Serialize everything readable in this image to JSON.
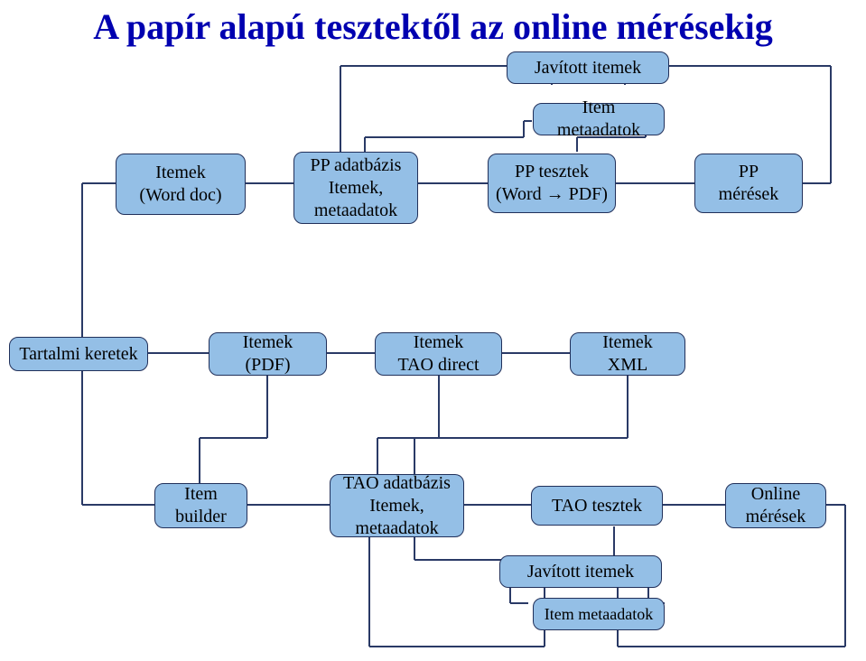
{
  "title": "A papír alapú tesztektől az online mérésekig",
  "boxes": {
    "javitott_itemek_top": "Javított itemek",
    "item_metaadatok_top": "Item metaadatok",
    "itemek_worddoc": "Itemek\n(Word doc)",
    "pp_adatbazis": "PP adatbázis\nItemek,\nmetaadatok",
    "pp_tesztek": "PP tesztek\n(Word → PDF)",
    "pp_meresek": "PP\nmérések",
    "tartalmi_keretek": "Tartalmi keretek",
    "itemek_pdf": "Itemek\n(PDF)",
    "itemek_tao_direct": "Itemek\nTAO direct",
    "itemek_xml": "Itemek\nXML",
    "item_builder": "Item\nbuilder",
    "tao_adatbazis": "TAO adatbázis\nItemek,\nmetaadatok",
    "tao_tesztek": "TAO tesztek",
    "online_meresek": "Online\nmérések",
    "javitott_itemek_bottom": "Javított itemek",
    "item_metaadatok_bottom": "Item metaadatok"
  }
}
